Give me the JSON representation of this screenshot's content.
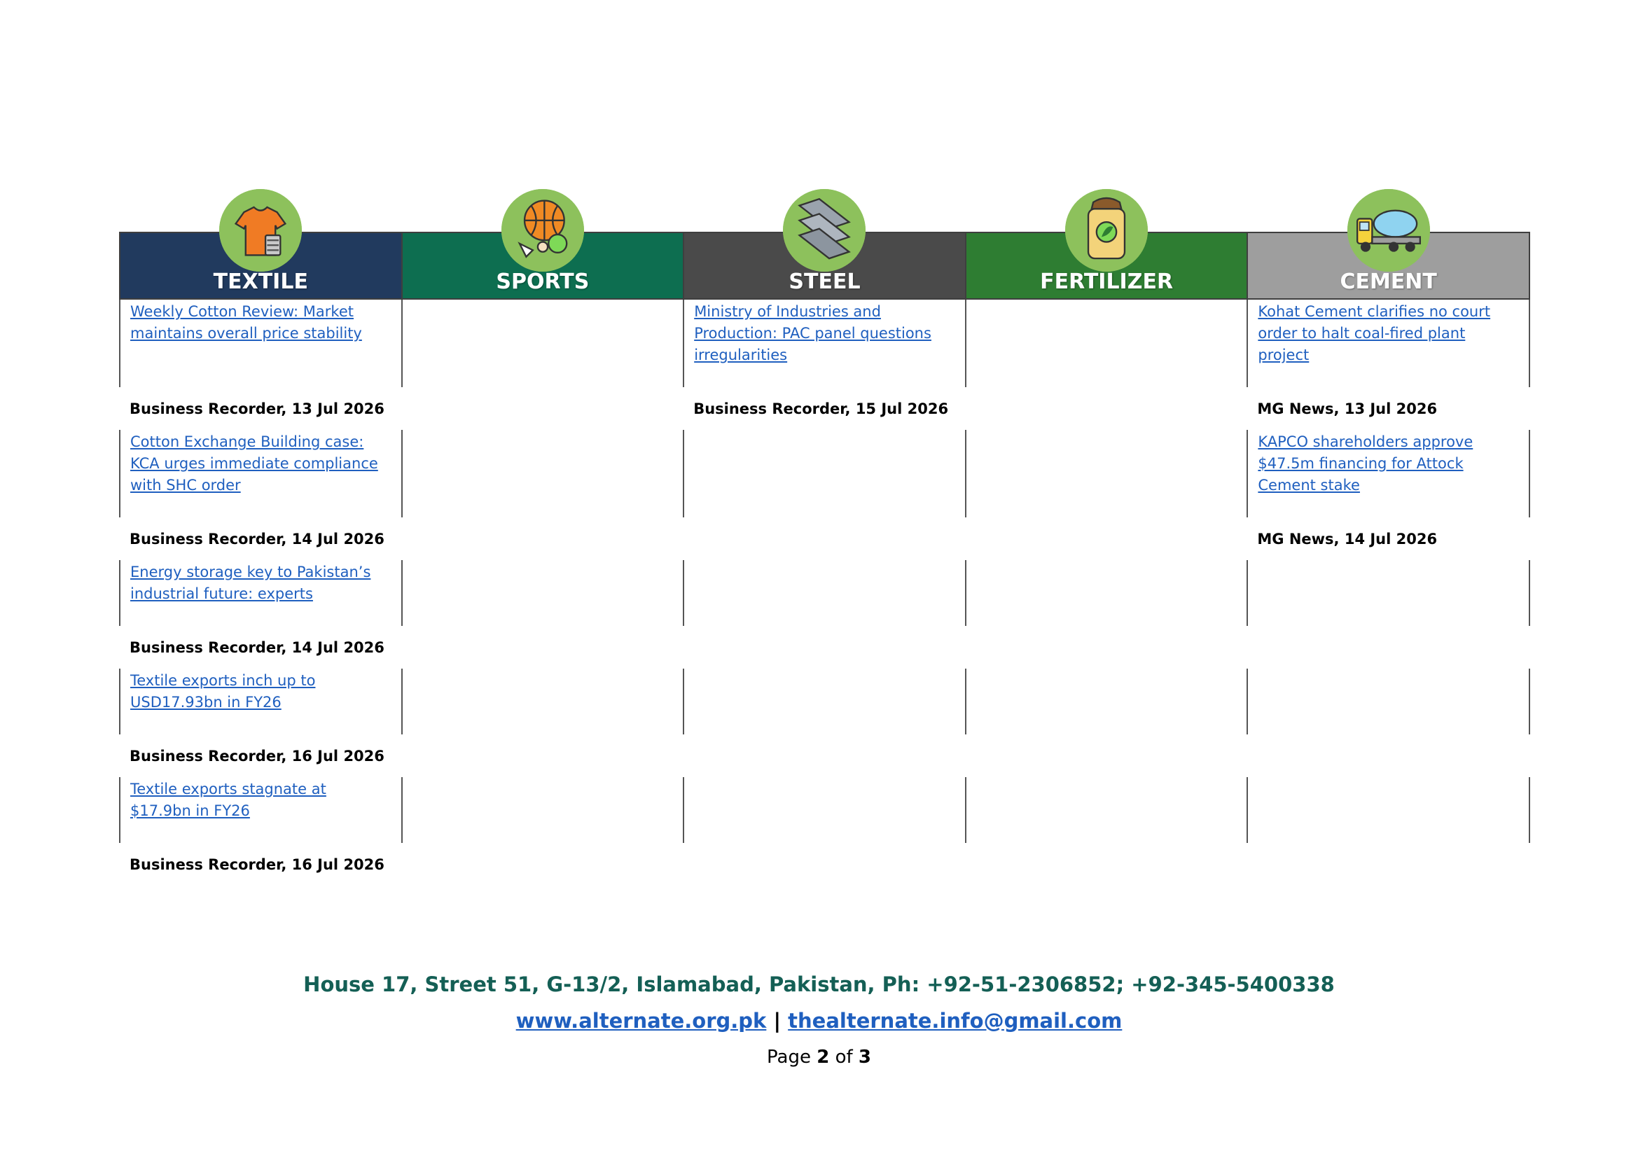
{
  "sectors": [
    {
      "title": "TEXTILE",
      "color": "#213a5e",
      "icon": "t-shirt-icon"
    },
    {
      "title": "SPORTS",
      "color": "#0d6e50",
      "icon": "sports-balls-icon"
    },
    {
      "title": "STEEL",
      "color": "#4a4a4a",
      "icon": "steel-beams-icon"
    },
    {
      "title": "FERTILIZER",
      "color": "#2e7d32",
      "icon": "fertilizer-sack-icon"
    },
    {
      "title": "CEMENT",
      "color": "#9e9e9e",
      "icon": "cement-mixer-truck-icon"
    }
  ],
  "rows": [
    {
      "articles": [
        {
          "title": "Weekly Cotton Review: Market maintains overall price stability",
          "source": "Business Recorder, 13 Jul 2026"
        },
        null,
        {
          "title": "Ministry of Industries and Production: PAC panel questions irregularities",
          "source": "Business Recorder, 15 Jul 2026"
        },
        null,
        {
          "title": "Kohat Cement clarifies no court order to halt coal-fired plant project",
          "source": "MG News, 13 Jul 2026"
        }
      ]
    },
    {
      "articles": [
        {
          "title": "Cotton Exchange Building case: KCA urges immediate compliance with SHC order",
          "source": "Business Recorder, 14 Jul 2026"
        },
        null,
        null,
        null,
        {
          "title": "KAPCO shareholders approve $47.5m financing for Attock Cement stake",
          "source": "MG News, 14 Jul 2026"
        }
      ]
    },
    {
      "articles": [
        {
          "title": "Energy storage key to Pakistan’s industrial future: experts",
          "source": "Business Recorder, 14 Jul 2026"
        },
        null,
        null,
        null,
        null
      ]
    },
    {
      "articles": [
        {
          "title": "Textile exports inch up to USD17.93bn in FY26",
          "source": "Business Recorder, 16 Jul 2026"
        },
        null,
        null,
        null,
        null
      ]
    },
    {
      "articles": [
        {
          "title": "Textile exports stagnate at $17.9bn in FY26",
          "source": "Business Recorder, 16 Jul 2026"
        },
        null,
        null,
        null,
        null
      ]
    }
  ],
  "footer": {
    "address": "House 17, Street 51, G-13/2, Islamabad, Pakistan, Ph: +92-51-2306852; +92-345-5400338",
    "website": "www.alternate.org.pk",
    "separator": "|",
    "email": "thealternate.info@gmail.com",
    "page_label": "Page",
    "page_current": "2",
    "page_of": "of",
    "page_total": "3"
  }
}
